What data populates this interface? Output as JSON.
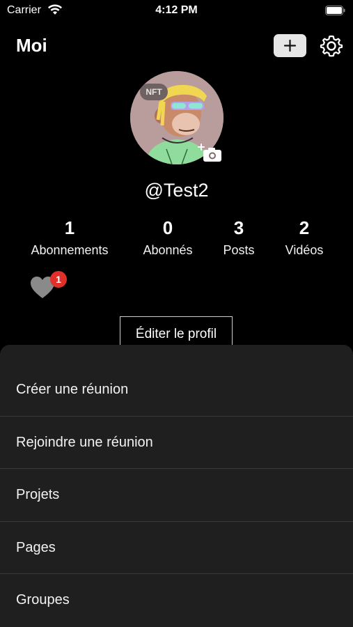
{
  "status_bar": {
    "carrier": "Carrier",
    "time": "4:12 PM"
  },
  "header": {
    "title": "Moi",
    "add_icon": "plus-icon",
    "settings_icon": "gear-icon"
  },
  "profile": {
    "avatar_badge": "NFT",
    "username": "@Test2",
    "stats": [
      {
        "value": "1",
        "label": "Abonnements"
      },
      {
        "value": "0",
        "label": "Abonnés"
      },
      {
        "value": "3",
        "label": "Posts"
      },
      {
        "value": "2",
        "label": "Vidéos"
      }
    ],
    "likes_badge": "1",
    "edit_label": "Éditer le profil"
  },
  "sheet": {
    "items": [
      {
        "label": "Créer une réunion"
      },
      {
        "label": "Rejoindre une réunion"
      },
      {
        "label": "Projets"
      },
      {
        "label": "Pages"
      },
      {
        "label": "Groupes"
      }
    ]
  },
  "colors": {
    "background": "#000000",
    "sheet": "#1f1f1f",
    "badge": "#e0302b"
  }
}
